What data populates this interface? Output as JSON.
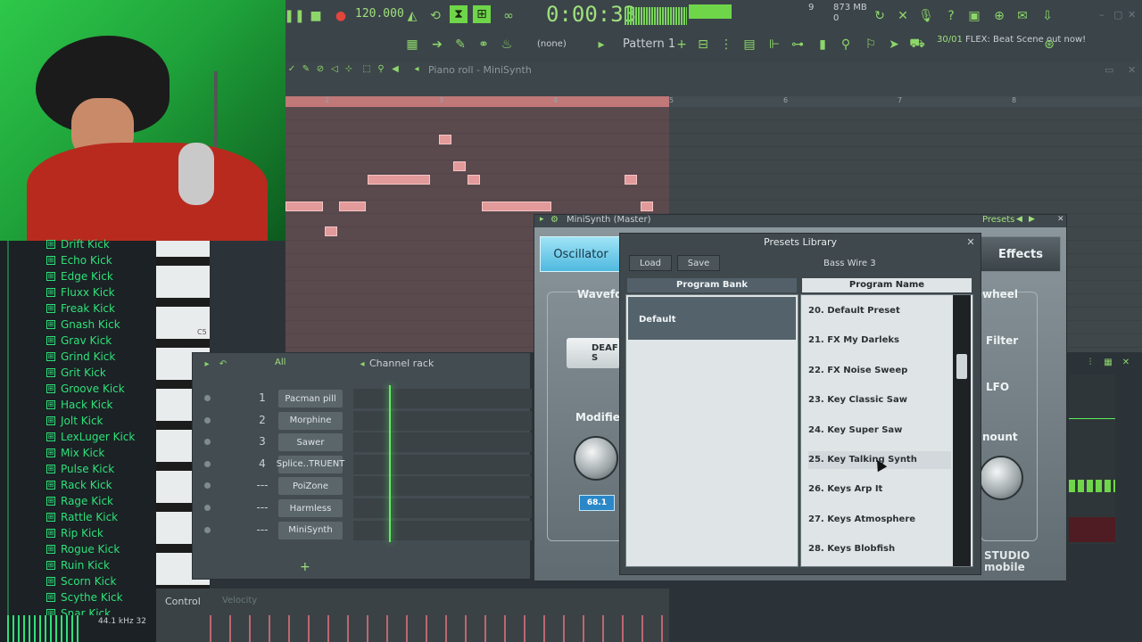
{
  "toolbar": {
    "tempo": "120.000",
    "time": "0:00:33",
    "memory": "873 MB",
    "cpu_num": "9",
    "mem_sub": "0",
    "pattern": "Pattern 1",
    "snap": "(none)",
    "news_num": "30/01",
    "news_text": "FLEX: Beat Scene out now!"
  },
  "pianoroll": {
    "title": "Piano roll - MiniSynth",
    "bars": [
      "2",
      "3",
      "4",
      "5",
      "6",
      "7",
      "8"
    ],
    "key_label": "C5"
  },
  "browser": {
    "items": [
      "Drift Kick",
      "Echo Kick",
      "Edge Kick",
      "Fluxx Kick",
      "Freak Kick",
      "Gnash Kick",
      "Grav Kick",
      "Grind Kick",
      "Grit Kick",
      "Groove Kick",
      "Hack Kick",
      "Jolt Kick",
      "LexLuger Kick",
      "Mix Kick",
      "Pulse Kick",
      "Rack Kick",
      "Rage Kick",
      "Rattle Kick",
      "Rip Kick",
      "Rogue Kick",
      "Ruin Kick",
      "Scorn Kick",
      "Scythe Kick",
      "Snar Kick"
    ],
    "sample_rate": "44.1 kHz 32"
  },
  "channel_rack": {
    "title": "Channel rack",
    "filter": "All",
    "channels": [
      {
        "num": "1",
        "name": "Pacman pill"
      },
      {
        "num": "2",
        "name": "Morphine"
      },
      {
        "num": "3",
        "name": "Sawer"
      },
      {
        "num": "4",
        "name": "Splice..TRUENT"
      },
      {
        "num": "---",
        "name": "PoiZone"
      },
      {
        "num": "---",
        "name": "Harmless"
      },
      {
        "num": "---",
        "name": "MiniSynth"
      }
    ]
  },
  "control": {
    "label": "Control",
    "velocity": "Velocity"
  },
  "minisynth": {
    "title": "MiniSynth (Master)",
    "presets_label": "Presets",
    "tab_oscillator": "Oscillator",
    "tab_effects": "Effects",
    "waveform_label": "Wavefo",
    "deaf_label": "DEAF S",
    "modifier_label": "Modifier",
    "knob_value": "68.1",
    "wheel_label": "wheel",
    "filter_label": "Filter",
    "lfo_label": "LFO",
    "amount_label": "nount",
    "logo_top": "STUDIO",
    "logo_bottom": "mobile"
  },
  "presets_library": {
    "title": "Presets Library",
    "load": "Load",
    "save": "Save",
    "current_preset": "Bass Wire 3",
    "bank_header": "Program Bank",
    "name_header": "Program Name",
    "bank_selected": "Default",
    "programs": [
      "20. Default Preset",
      "21. FX My Darleks",
      "22. FX Noise Sweep",
      "23. Key Classic Saw",
      "24. Key Super Saw",
      "25. Key Talking Synth",
      "26. Keys Arp It",
      "27. Keys Atmosphere",
      "28. Keys Blobfish"
    ],
    "highlighted_index": 5
  },
  "colors": {
    "accent_green": "#9fe07d",
    "browser_green": "#2fe07a",
    "note_pink": "#e29a9a",
    "osc_tab_blue": "#4fb9df"
  }
}
